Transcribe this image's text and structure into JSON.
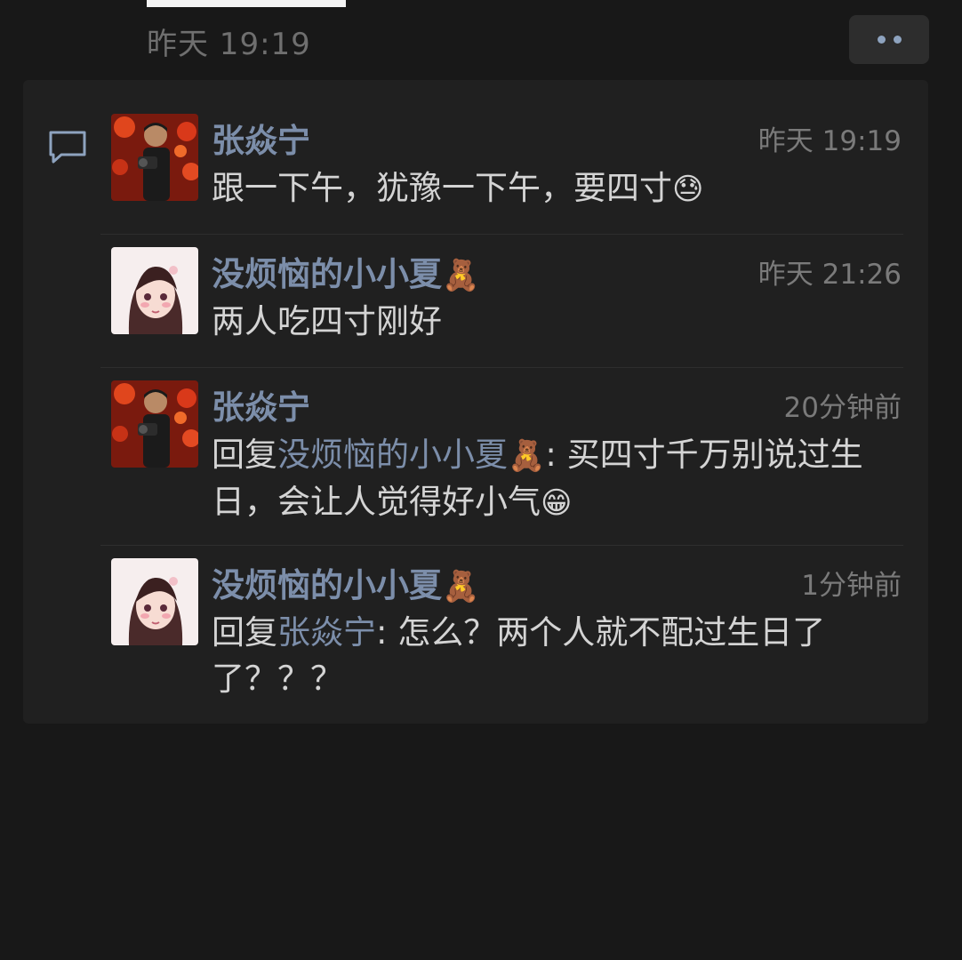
{
  "header": {
    "post_time": "昨天 19:19",
    "more_icon": "more-dots-icon"
  },
  "comments": [
    {
      "nickname": "张焱宁",
      "time": "昨天 19:19",
      "text": "跟一下午，犹豫一下午，要四寸",
      "emoji": "😓",
      "avatar": "avatar-photo-man-camera"
    },
    {
      "nickname": "没烦恼的小小夏",
      "nickname_emoji": "🧸",
      "time": "昨天 21:26",
      "text": "两人吃四寸刚好",
      "avatar": "avatar-anime-girl"
    },
    {
      "nickname": "张焱宁",
      "time": "20分钟前",
      "reply_prefix": "回复",
      "reply_to": "没烦恼的小小夏",
      "reply_to_emoji": "🧸",
      "text": ": 买四寸千万别说过生日，会让人觉得好小气",
      "emoji": "😁",
      "avatar": "avatar-photo-man-camera"
    },
    {
      "nickname": "没烦恼的小小夏",
      "nickname_emoji": "🧸",
      "time": "1分钟前",
      "reply_prefix": "回复",
      "reply_to": "张焱宁",
      "text": ": 怎么？两个人就不配过生日了了？？？",
      "avatar": "avatar-anime-girl"
    }
  ],
  "colors": {
    "background": "#181818",
    "panel": "#202020",
    "nickname": "#7c8eaa",
    "text": "#d4d4d4",
    "time": "#7a7a7a"
  }
}
